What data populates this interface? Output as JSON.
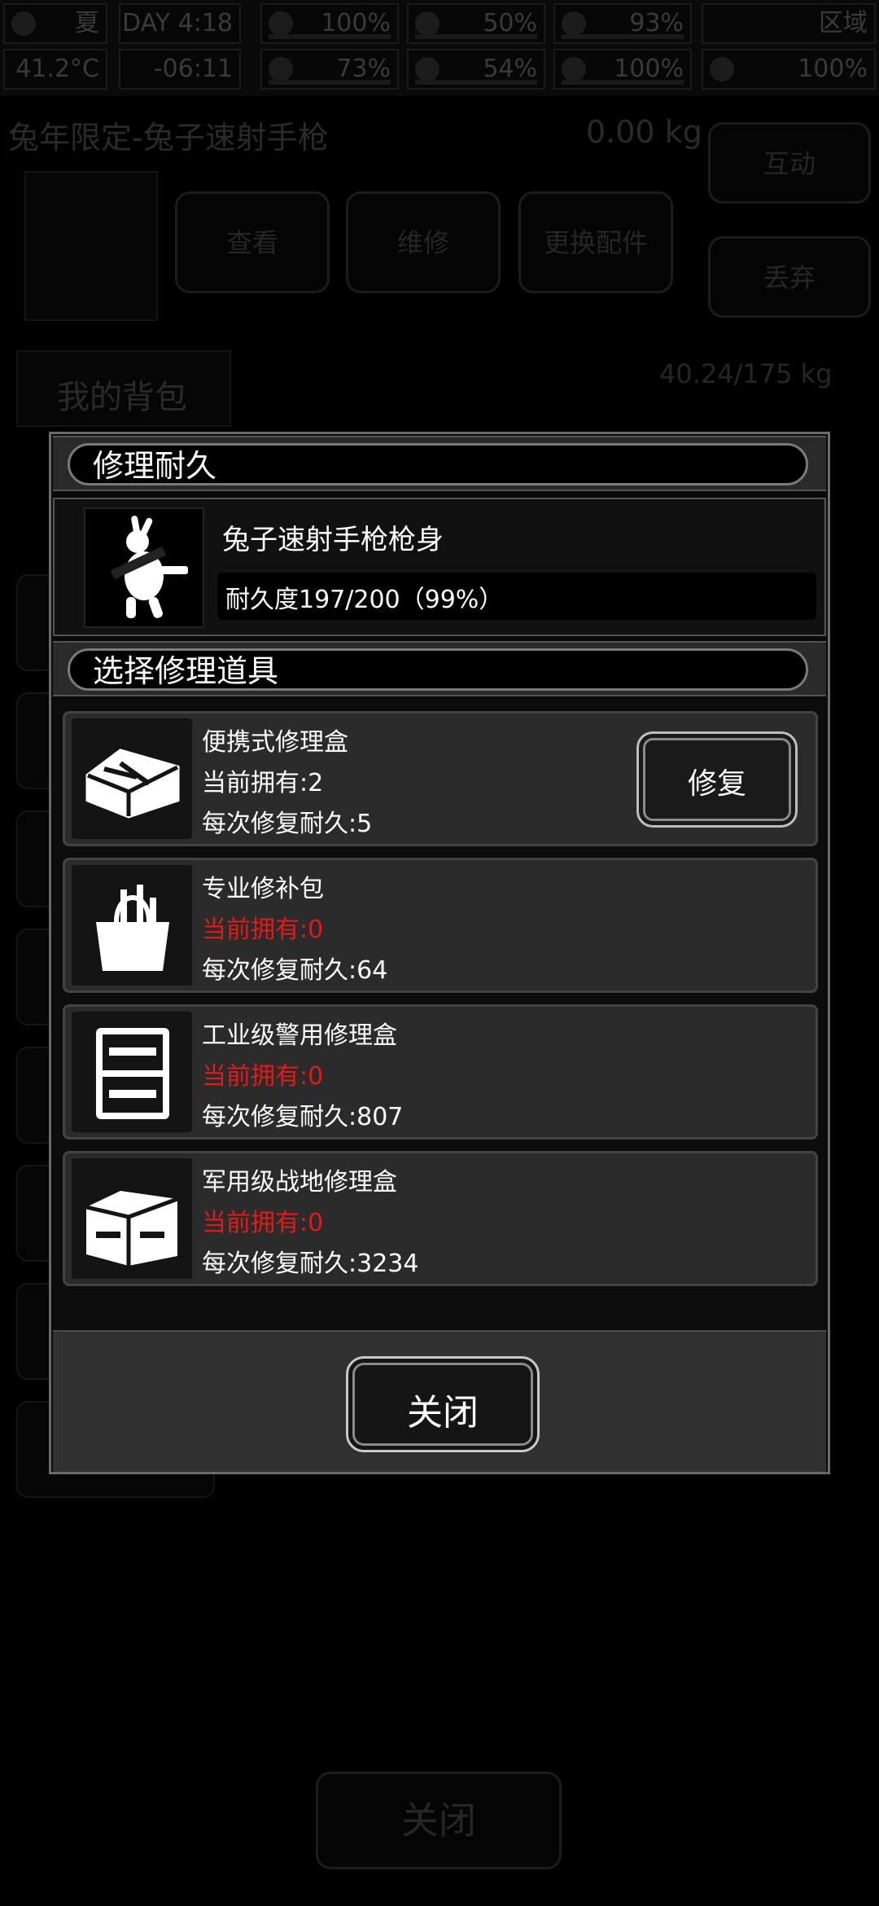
{
  "background": {
    "hud": {
      "row1": [
        "夏",
        "DAY 4:18",
        "100%",
        "50%",
        "93%",
        "区域"
      ],
      "row2": [
        "41.2°C",
        "-06:11",
        "73%",
        "54%",
        "100%",
        "100%"
      ]
    },
    "weapon_title": "兔年限定-兔子速射手枪",
    "weapon_weight": "0.00 kg",
    "interact_label": "互动",
    "view_label": "查看",
    "repair_label": "维修",
    "replace_label": "更换配件",
    "discard_label": "丢弃",
    "bag_label": "我的背包",
    "bag_weight": "40.24/175 kg",
    "close_label": "关闭"
  },
  "modal": {
    "repair_header": "修理耐久",
    "item": {
      "name": "兔子速射手枪枪身",
      "durability": "耐久度197/200（99%）"
    },
    "tools_header": "选择修理道具",
    "tools": [
      {
        "name": "便携式修理盒",
        "have": "当前拥有:2",
        "per": "每次修复耐久:5",
        "icon": "toolbox-icon",
        "available": true
      },
      {
        "name": "专业修补包",
        "have": "当前拥有:0",
        "per": "每次修复耐久:64",
        "icon": "tool-bag-icon",
        "available": false
      },
      {
        "name": "工业级警用修理盒",
        "have": "当前拥有:0",
        "per": "每次修复耐久:807",
        "icon": "tool-case-icon",
        "available": false
      },
      {
        "name": "军用级战地修理盒",
        "have": "当前拥有:0",
        "per": "每次修复耐久:3234",
        "icon": "tool-chest-icon",
        "available": false
      }
    ],
    "repair_button": "修复",
    "close_button": "关闭"
  },
  "colors": {
    "unavailable": "#e21a1a",
    "card_bg": "#2b2b2b",
    "modal_border": "#6a6a6a"
  }
}
